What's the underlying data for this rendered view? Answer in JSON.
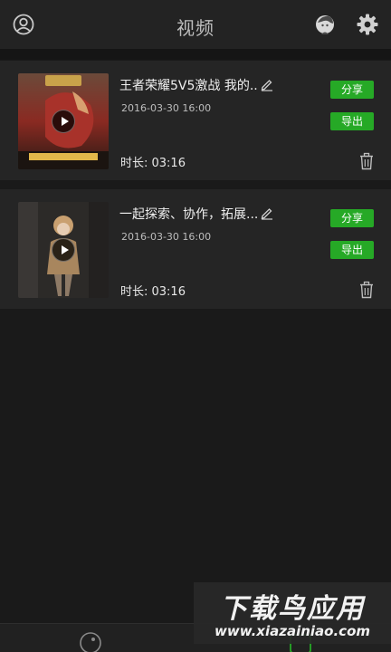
{
  "header": {
    "title": "视频",
    "left_icon": "user-circle-icon",
    "right_icons": [
      "user-avatar-icon",
      "gear-icon"
    ]
  },
  "videos": [
    {
      "title": "王者荣耀5V5激战 我的...",
      "date": "2016-03-30  16:00",
      "duration": "时长: 03:16",
      "share_label": "分享",
      "export_label": "导出"
    },
    {
      "title": "一起探索、协作，拓展...",
      "date": "2016-03-30  16:00",
      "duration": "时长: 03:16",
      "share_label": "分享",
      "export_label": "导出"
    }
  ],
  "watermark": {
    "name": "下载鸟应用",
    "url": "www.xiazainiao.com"
  },
  "colors": {
    "accent_green": "#26a926",
    "background": "#1a1a1a",
    "card": "#252525"
  }
}
